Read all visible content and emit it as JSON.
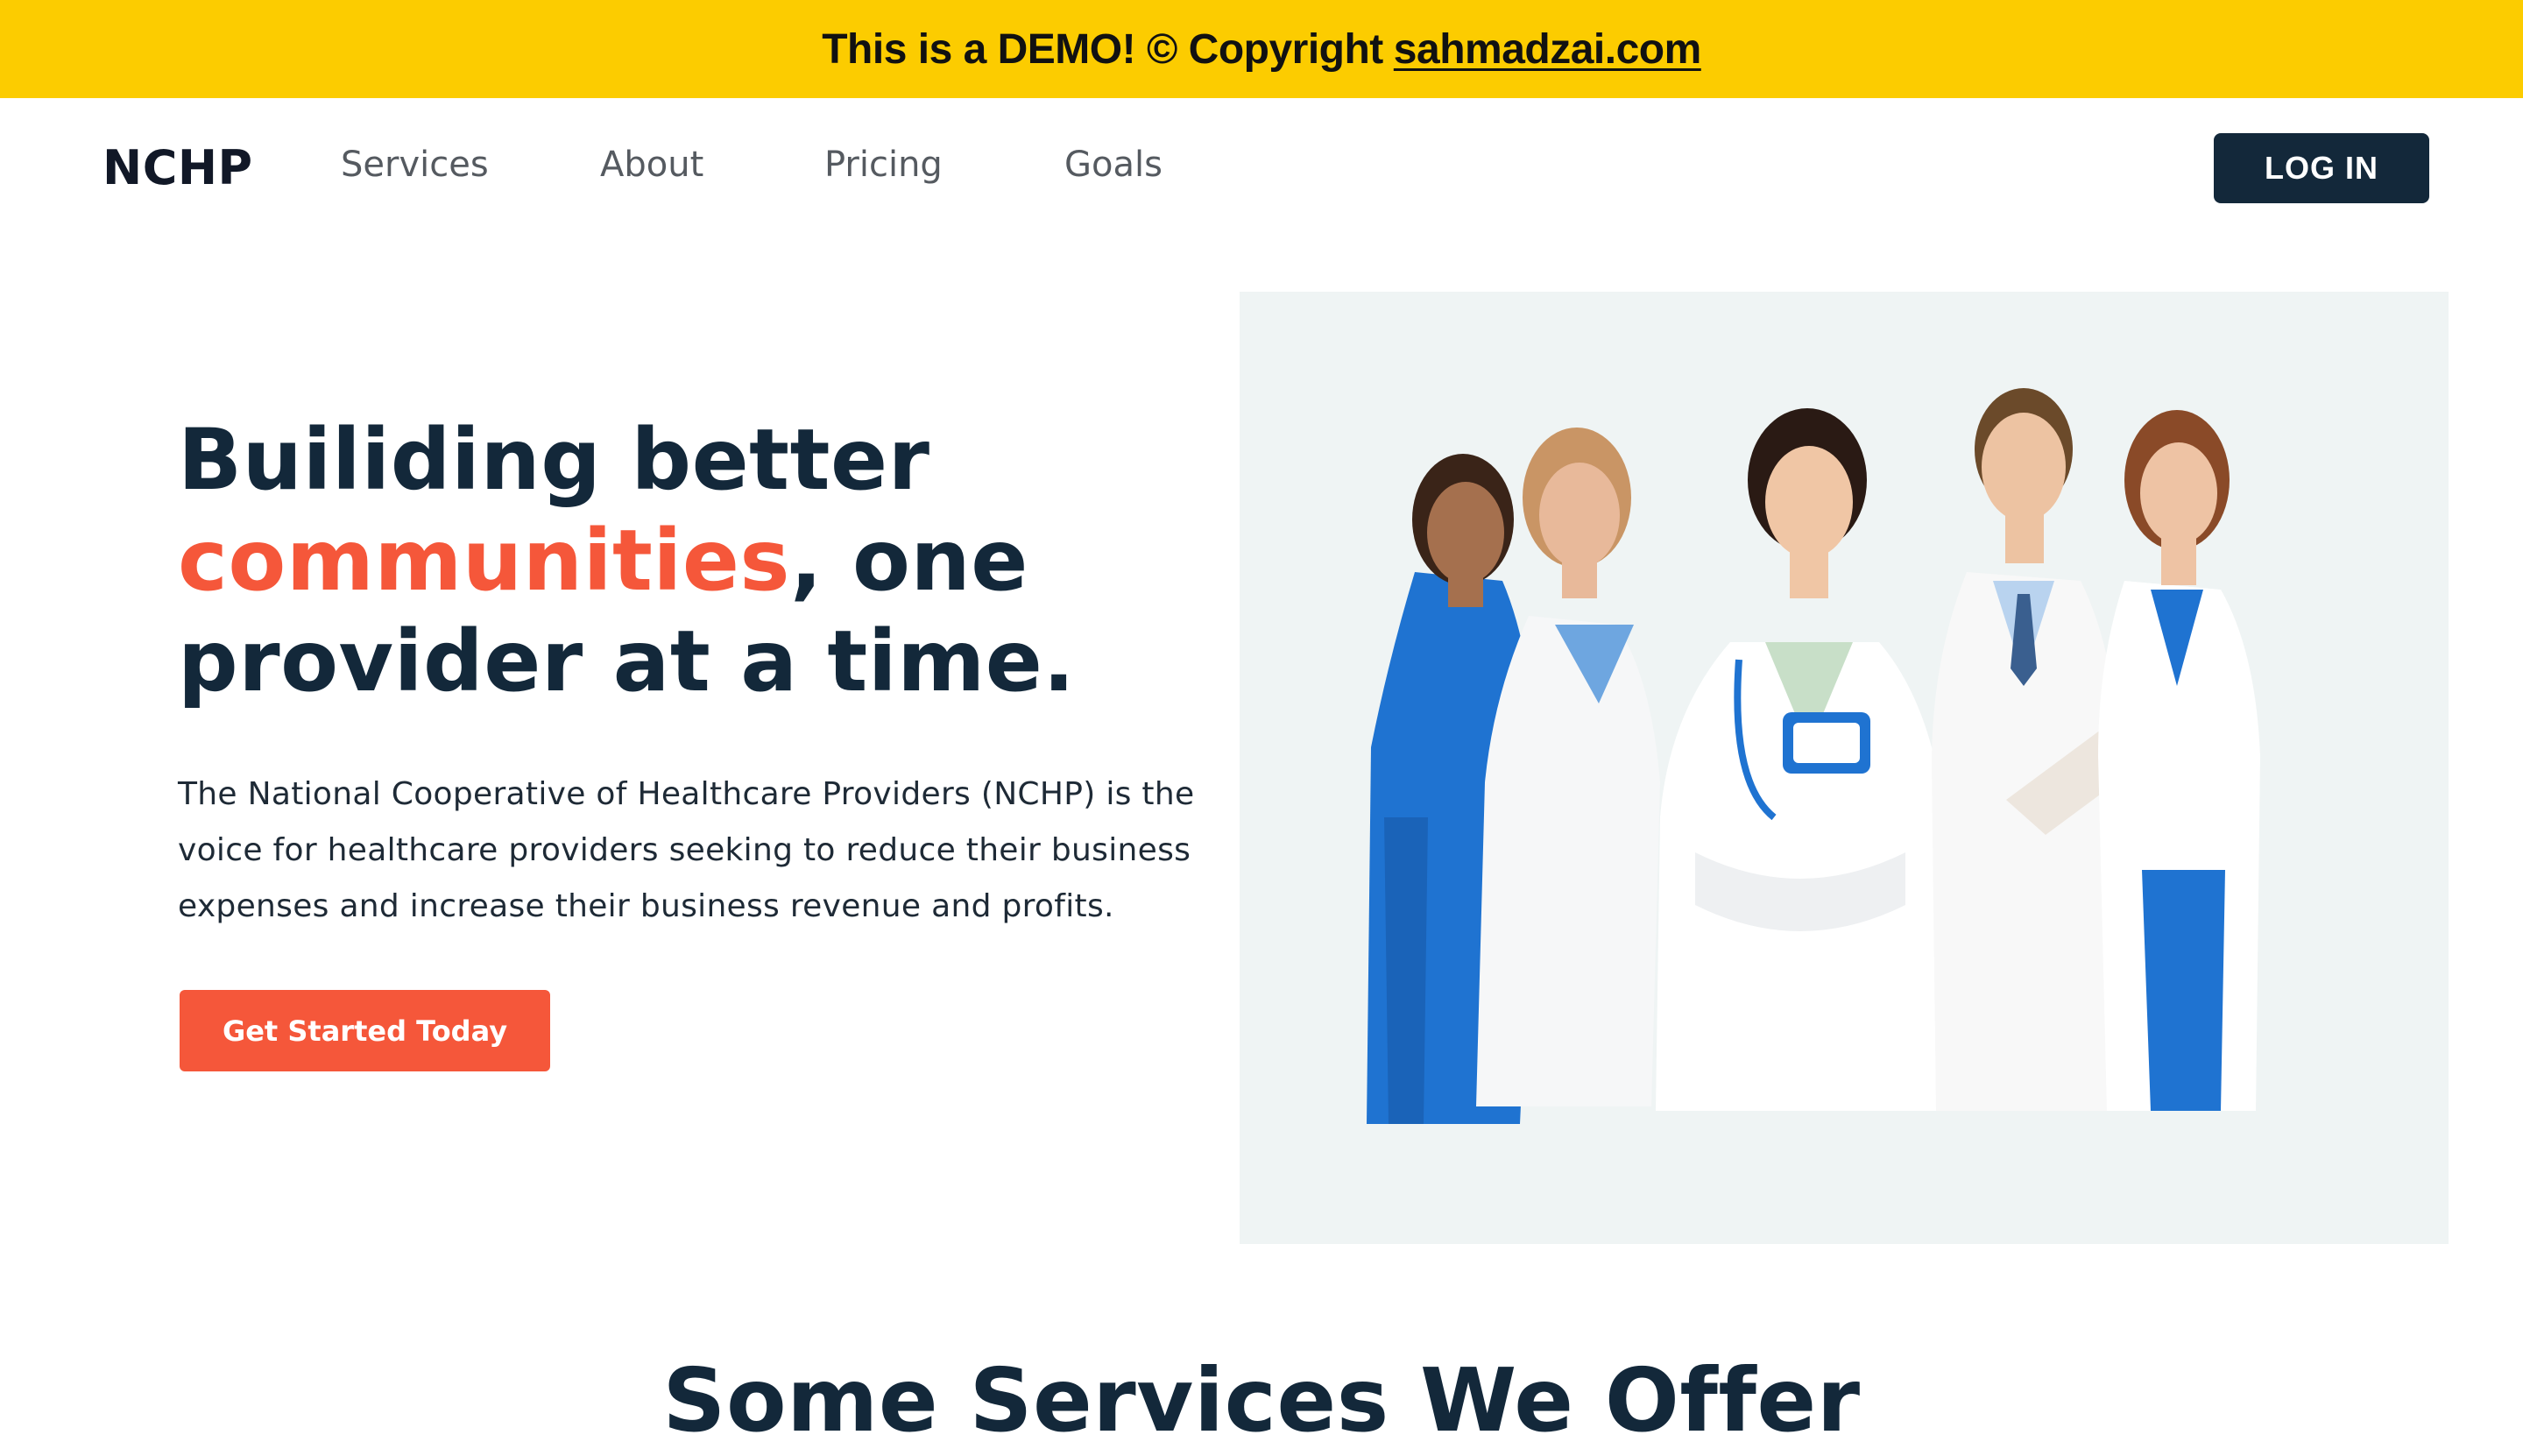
{
  "banner": {
    "text": "This is a DEMO! © Copyright",
    "link_text": "sahmadzai.com",
    "bg_color": "#fccc00"
  },
  "nav": {
    "logo": "NCHP",
    "links": [
      "Services",
      "About",
      "Pricing",
      "Goals"
    ],
    "login_label": "LOG IN"
  },
  "hero": {
    "title_line1": "Builiding better",
    "title_accent": "communities",
    "title_after_accent": ", one",
    "title_line3": "provider at a time.",
    "description": "The National Cooperative of Healthcare Providers (NCHP) is the voice for healthcare providers seeking to reduce their business expenses and increase their business revenue and profits.",
    "cta_label": "Get Started Today",
    "accent_color": "#f5573a",
    "dark_color": "#13283a"
  },
  "services": {
    "heading": "Some Services We Offer"
  }
}
